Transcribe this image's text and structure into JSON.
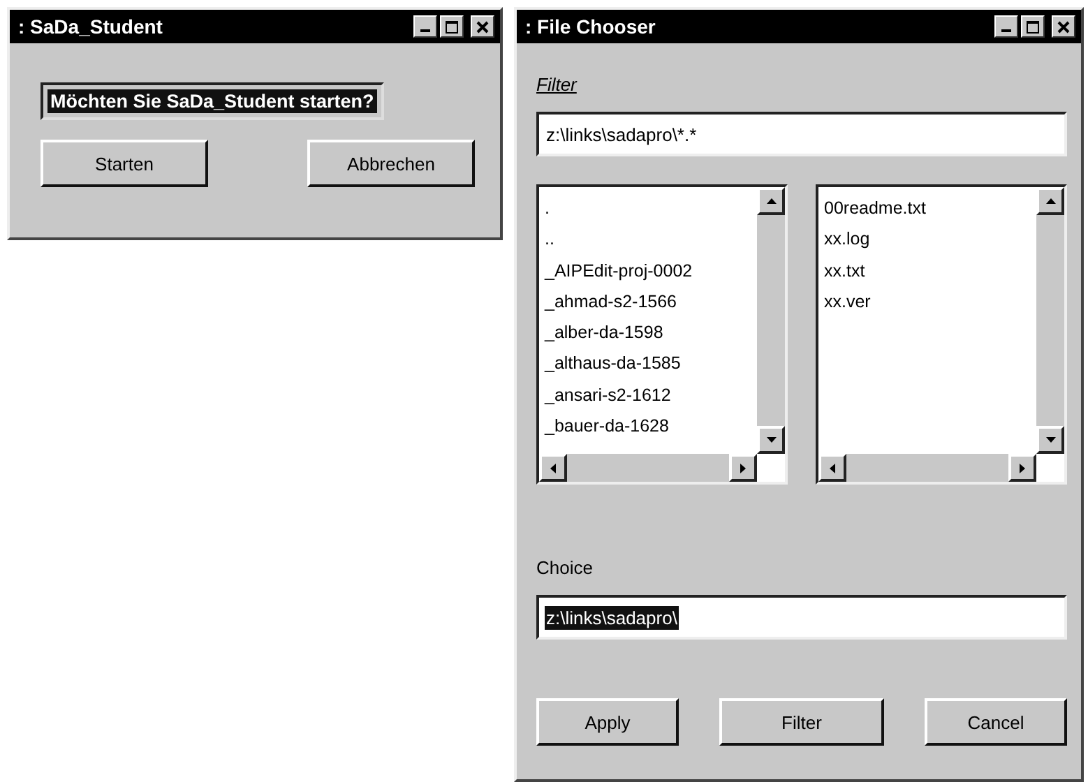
{
  "windows": [
    {
      "kind": "prompt",
      "title": ": SaDa_Student",
      "message": {
        "text": "Möchten Sie SaDa_Student starten?",
        "highlighted": true
      },
      "buttons": [
        "Starten",
        "Abbrechen"
      ]
    },
    {
      "kind": "chooser",
      "title": ": File Chooser",
      "filter": {
        "label": "Filter",
        "value": "z:\\links\\sadapro\\*.*"
      },
      "directories": [
        ".",
        "..",
        "_AIPEdit-proj-0002",
        "_ahmad-s2-1566",
        "_alber-da-1598",
        "_althaus-da-1585",
        "_ansari-s2-1612",
        "_bauer-da-1628"
      ],
      "files": [
        "00readme.txt",
        "xx.log",
        "xx.txt",
        "xx.ver"
      ],
      "choice": {
        "label": "Choice",
        "value": "z:\\links\\sadapro\\",
        "highlighted": true
      },
      "buttons": [
        "Apply",
        "Filter",
        "Cancel"
      ]
    }
  ]
}
